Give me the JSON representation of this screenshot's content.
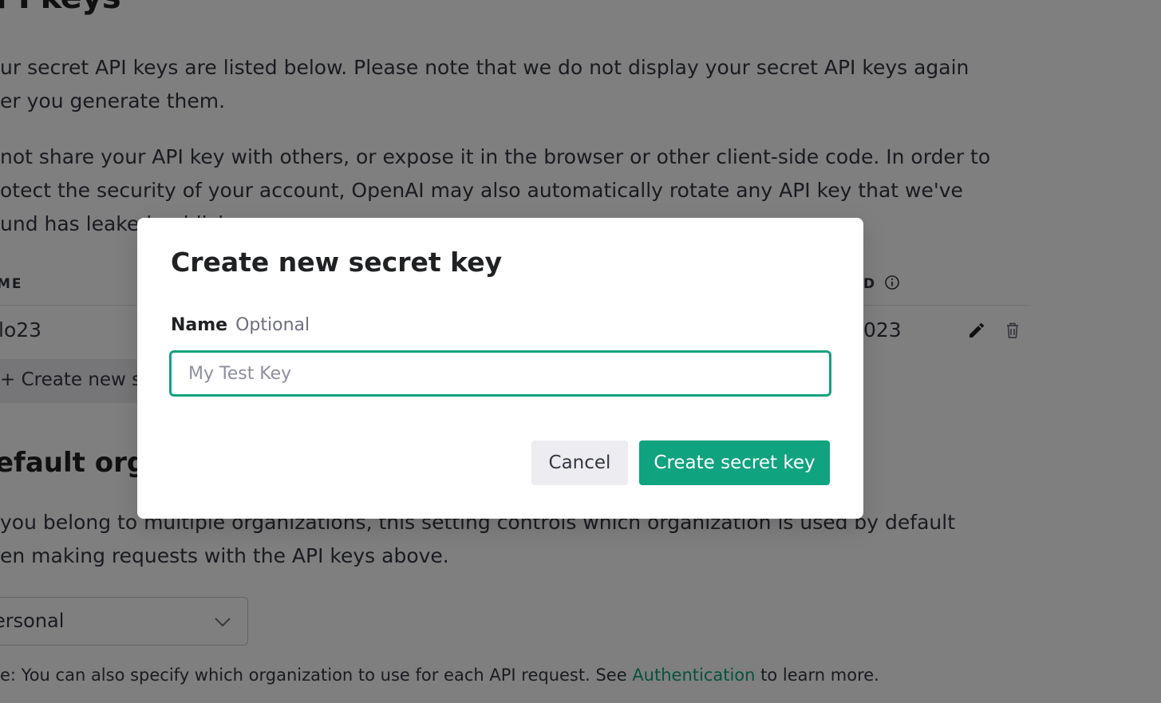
{
  "background": {
    "page_title": "PI keys",
    "intro_line1": "ur secret API keys are listed below. Please note that we do not display your secret API keys again",
    "intro_line2": "er you generate them.",
    "warn_line1": "not share your API key with others, or expose it in the browser or other client-side code. In order to",
    "warn_line2": "otect the security of your account, OpenAI may also automatically rotate any API key that we've",
    "warn_line3": "und has leaked publicly.",
    "table": {
      "col_name": "ME",
      "col_right": "D",
      "row_name": "lo23",
      "row_date": "023"
    },
    "create_button_label": "+ Create new se",
    "section_title": "efault organ",
    "org_line1": "you belong to multiple organizations, this setting controls which organization is used by default",
    "org_line2": "en making requests with the API keys above.",
    "org_select_value": "ersonal",
    "note_prefix": "e: You can also specify which organization to use for each API request. See ",
    "note_link": "Authentication",
    "note_suffix": " to learn more."
  },
  "modal": {
    "title": "Create new secret key",
    "field_label": "Name",
    "field_hint": "Optional",
    "input_value": "",
    "input_placeholder": "My Test Key",
    "cancel_label": "Cancel",
    "submit_label": "Create secret key"
  },
  "colors": {
    "accent": "#10a37f",
    "overlay": "rgba(0,0,0,0.5)",
    "secondary_button": "#ececf1"
  },
  "icons": {
    "info": "info-icon",
    "edit": "pencil-icon",
    "delete": "trash-icon",
    "select": "chevron-down-icon"
  }
}
